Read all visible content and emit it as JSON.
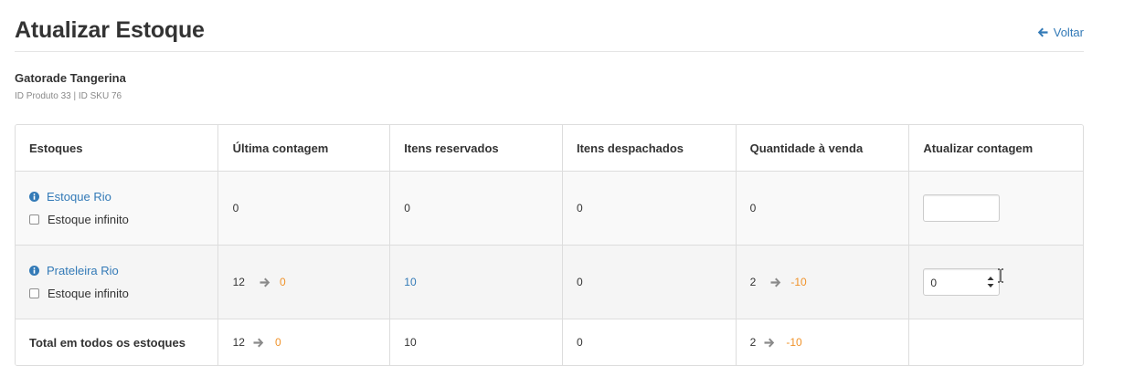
{
  "header": {
    "title": "Atualizar Estoque",
    "back_label": "Voltar"
  },
  "product": {
    "name": "Gatorade Tangerina",
    "ids": "ID Produto 33 | ID SKU 76"
  },
  "table": {
    "columns": [
      "Estoques",
      "Última contagem",
      "Itens reservados",
      "Itens despachados",
      "Quantidade à venda",
      "Atualizar contagem"
    ],
    "rows": [
      {
        "stock_name": "Estoque Rio",
        "infinite_label": "Estoque infinito",
        "last_count": "0",
        "reserved": "0",
        "dispatched": "0",
        "available": "0",
        "update_value": ""
      },
      {
        "stock_name": "Prateleira Rio",
        "infinite_label": "Estoque infinito",
        "last_count": "12",
        "last_count_new": "0",
        "reserved": "10",
        "dispatched": "0",
        "available": "2",
        "available_new": "-10",
        "update_value": "0"
      }
    ],
    "total": {
      "label": "Total em todos os estoques",
      "last_count": "12",
      "last_count_new": "0",
      "reserved": "10",
      "dispatched": "0",
      "available": "2",
      "available_new": "-10"
    }
  },
  "colors": {
    "link": "#337ab7",
    "change": "#f0932b",
    "border": "#dddddd"
  },
  "icons": [
    "arrow-left-icon",
    "info-icon",
    "arrow-right-icon",
    "spinner-icon"
  ]
}
